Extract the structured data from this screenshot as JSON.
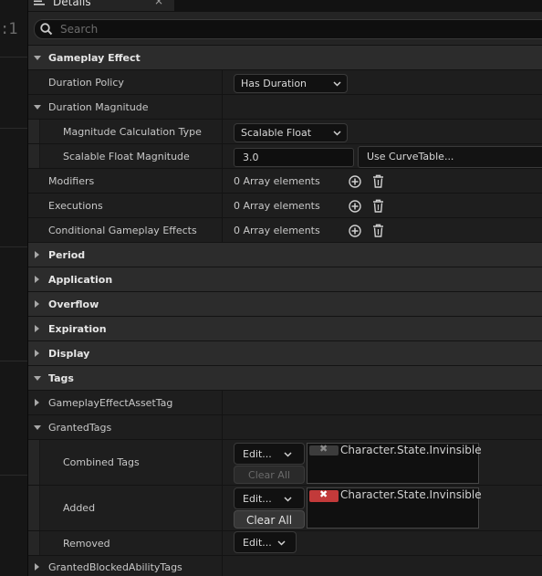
{
  "background_label": ":1",
  "tab": {
    "title": "Details",
    "close": "×"
  },
  "search": {
    "placeholder": "Search"
  },
  "sections": {
    "gameplay_effect": "Gameplay Effect",
    "period": "Period",
    "application": "Application",
    "overflow": "Overflow",
    "expiration": "Expiration",
    "display": "Display",
    "tags": "Tags"
  },
  "props": {
    "duration_policy": {
      "label": "Duration Policy",
      "value": "Has Duration"
    },
    "duration_magnitude": {
      "label": "Duration Magnitude"
    },
    "magnitude_calc_type": {
      "label": "Magnitude Calculation Type",
      "value": "Scalable Float"
    },
    "scalable_float_magnitude": {
      "label": "Scalable Float Magnitude",
      "value": "3.0",
      "curve_table": "Use CurveTable..."
    },
    "modifiers": {
      "label": "Modifiers",
      "value": "0 Array elements"
    },
    "executions": {
      "label": "Executions",
      "value": "0 Array elements"
    },
    "conditional_effects": {
      "label": "Conditional Gameplay Effects",
      "value": "0 Array elements"
    },
    "asset_tag": {
      "label": "GameplayEffectAssetTag"
    },
    "granted_tags": {
      "label": "GrantedTags"
    },
    "combined_tags": {
      "label": "Combined Tags",
      "edit": "Edit...",
      "clear": "Clear All",
      "tag": "Character.State.Invinsible"
    },
    "added": {
      "label": "Added",
      "edit": "Edit...",
      "clear": "Clear All",
      "tag": "Character.State.Invinsible"
    },
    "removed": {
      "label": "Removed",
      "edit": "Edit..."
    },
    "granted_blocked": {
      "label": "GrantedBlockedAbilityTags"
    }
  },
  "colors": {
    "chip_disabled": "#3c3c3c",
    "chip_active": "#c23a3a"
  }
}
